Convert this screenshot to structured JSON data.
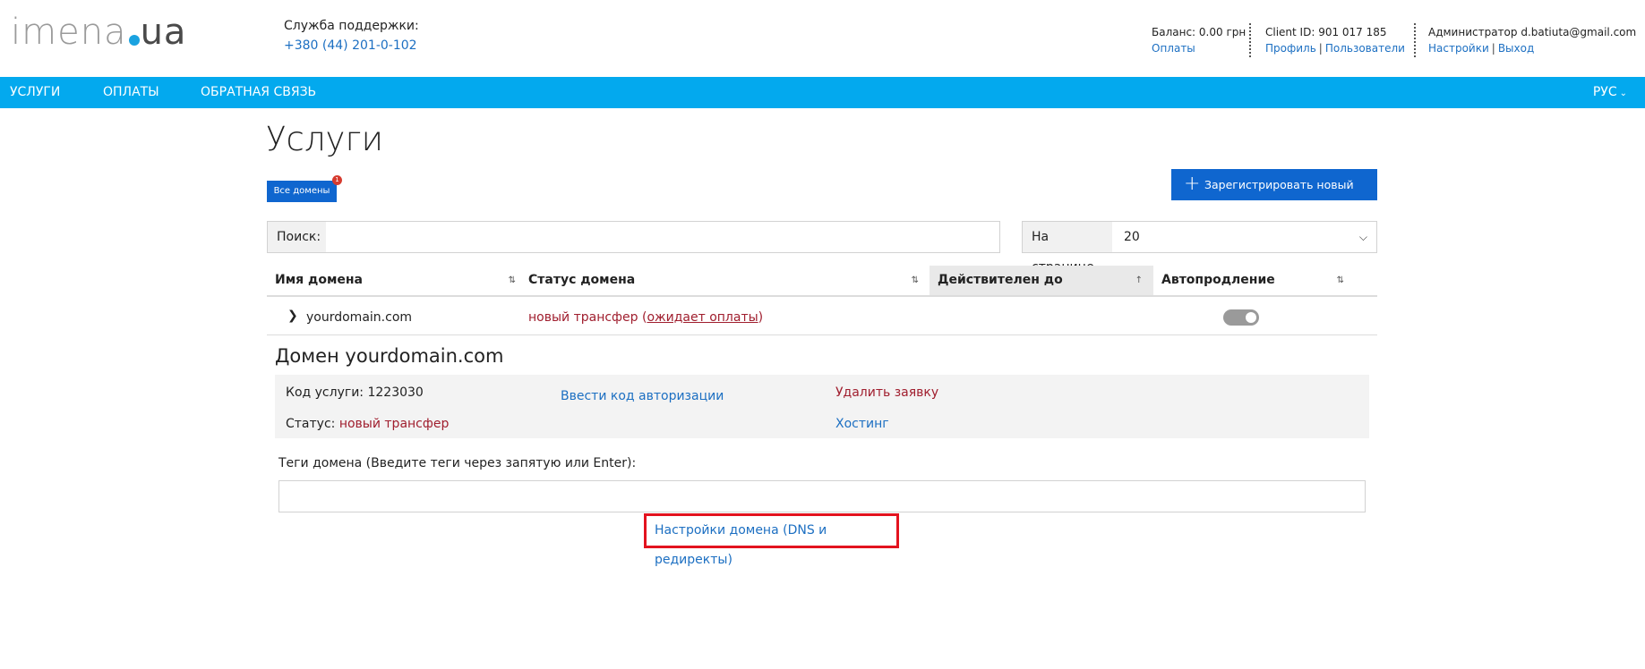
{
  "header": {
    "logo": {
      "word": "imena",
      "tld": "ua"
    },
    "support": {
      "label": "Служба поддержки:",
      "phone": "+380 (44) 201-0-102"
    },
    "balance": {
      "text": "Баланс: 0.00 грн",
      "link": "Оплаты"
    },
    "client": {
      "text": "Client ID: 901 017 185",
      "profile": "Профиль",
      "users": "Пользователи"
    },
    "admin": {
      "text": "Администратор d.batiuta@gmail.com",
      "settings": "Настройки",
      "logout": "Выход"
    },
    "separator": "|"
  },
  "nav": {
    "items": [
      "УСЛУГИ",
      "ОПЛАТЫ",
      "ОБРАТНАЯ СВЯЗЬ"
    ],
    "language": "РУС"
  },
  "main": {
    "title": "Услуги",
    "all_domains_button": "Все домены",
    "all_domains_badge": "1",
    "register_button": "Зарегистрировать новый домен",
    "search": {
      "label": "Поиск:",
      "value": "",
      "placeholder": ""
    },
    "per_page": {
      "label": "На странице",
      "value": "20"
    }
  },
  "table": {
    "columns": [
      "Имя домена",
      "Статус домена",
      "Действителен до",
      "Автопродление"
    ],
    "sort_icons": [
      "⇅",
      "⇅",
      "↑",
      "⇅"
    ],
    "active_sort_column": "Действителен до",
    "rows": [
      {
        "domain": "yourdomain.com",
        "status_prefix": "новый трансфер (",
        "status_link": "ожидает оплаты",
        "status_suffix": ")",
        "valid_until": "",
        "autorenew": true
      }
    ]
  },
  "detail": {
    "title": "Домен yourdomain.com",
    "service_code_label": "Код услуги:",
    "service_code": "1223030",
    "status_label": "Статус:",
    "status_value": "новый трансфер",
    "auth_code_link": "Ввести код авторизации",
    "delete_link": "Удалить заявку",
    "hosting_link": "Хостинг",
    "tags_label": "Теги домена (Введите теги через запятую или Enter):",
    "tags_value": "",
    "dns_link": "Настройки домена (DNS и редиректы)"
  },
  "colors": {
    "nav_bg": "#03a9ee",
    "button_blue": "#0f66cf",
    "link_blue": "#1c6fc2",
    "status_red": "#a01e2e",
    "highlight_box": "#e3131f"
  }
}
